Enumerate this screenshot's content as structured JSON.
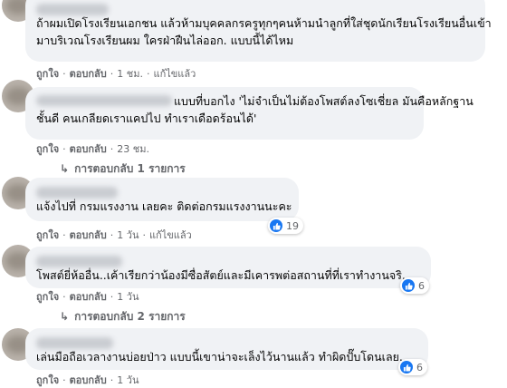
{
  "colors": {
    "bubble": "#f0f2f5",
    "meta_text": "#65676b",
    "like_blue": "#1877f2"
  },
  "comments": [
    {
      "lines": [
        "ถ้าผมเปิดโรงเรียนเอกชน แล้วห้ามบุคคลกรครูทุกๆคนห้ามนำลูกที่ใส่ชุดนักเรียนโรงเรียนอื่นเข้า",
        "มาบริเวณโรงเรียนผม ใครฝ่าฝืนไล่ออก. แบบนี้ได้ไหม"
      ],
      "like": "ถูกใจ",
      "reply": "ตอบกลับ",
      "time": "1 ชม.",
      "edited": "แก้ไขแล้ว"
    },
    {
      "lines": [
        "แบบที่บอกไง 'ไม่จำเป็นไม่ต้องโพสต์ลงโซเชี่ยล มันคือหลักฐาน",
        "ชั้นดี คนเกลียดเราแคปไป ทำเราเดือดร้อนได้'"
      ],
      "like": "ถูกใจ",
      "reply": "ตอบกลับ",
      "time": "23 ชม.",
      "replies_label": "การตอบกลับ 1 รายการ"
    },
    {
      "lines": [
        "แจ้งไปที่ กรมแรงงาน เลยคะ ติดต่อกรมแรงงานนะคะ"
      ],
      "like": "ถูกใจ",
      "reply": "ตอบกลับ",
      "time": "1 วัน",
      "edited": "แก้ไขแล้ว",
      "reaction_count": "19"
    },
    {
      "lines": [
        "โพสต์ยี่ห้ออื่น..เค้าเรียกว่าน้องมีซื่อสัตย์และมีเคารพต่อสถานที่ที่เราทำงานจริ.."
      ],
      "like": "ถูกใจ",
      "reply": "ตอบกลับ",
      "time": "1 วัน",
      "reaction_count": "6",
      "replies_label": "การตอบกลับ 2 รายการ"
    },
    {
      "lines": [
        "เล่นมือถือเวลางานบ่อยป่าว แบบนี้เขาน่าจะเล็งไว้นานแล้ว ทำผิดปั๊บโดนเลย.."
      ],
      "like": "ถูกใจ",
      "reply": "ตอบกลับ",
      "time": "1 วัน",
      "reaction_count": "6"
    }
  ]
}
